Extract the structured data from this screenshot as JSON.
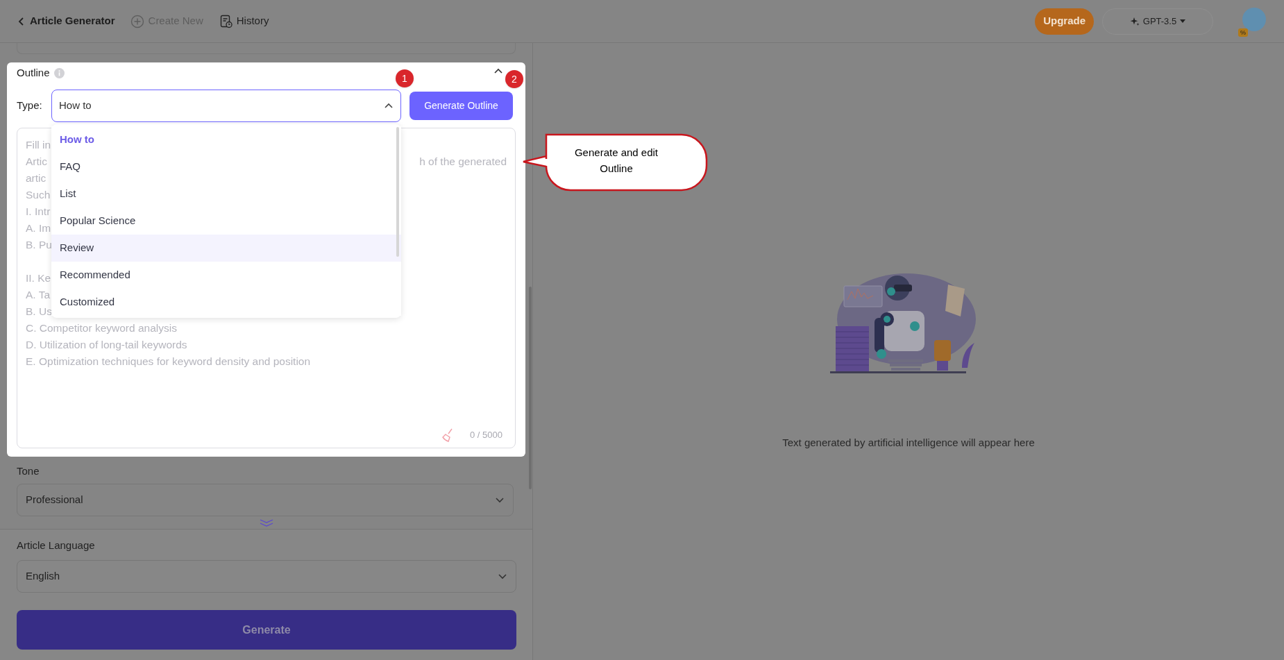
{
  "top_bar": {
    "back_label": "Article Generator",
    "create_new": "Create New",
    "history": "History",
    "upgrade": "Upgrade",
    "model": "GPT-3.5",
    "avatar_badge": "%"
  },
  "outline": {
    "title": "Outline",
    "expanded": true,
    "type_label": "Type:",
    "type_value": "How to",
    "dropdown_open": true,
    "options": [
      {
        "label": "How to",
        "selected": true,
        "hovered": false
      },
      {
        "label": "FAQ",
        "selected": false,
        "hovered": false
      },
      {
        "label": "List",
        "selected": false,
        "hovered": false
      },
      {
        "label": "Popular Science",
        "selected": false,
        "hovered": false
      },
      {
        "label": "Review",
        "selected": false,
        "hovered": true
      },
      {
        "label": "Recommended",
        "selected": false,
        "hovered": false
      },
      {
        "label": "Customized",
        "selected": false,
        "hovered": false
      }
    ],
    "generate_button": "Generate Outline",
    "placeholder_paragraphs": [
      [
        {
          "left": "Fill in"
        },
        {
          "left": "Artic",
          "right": "h of the generated"
        },
        {
          "left": "artic"
        },
        {
          "left": "Such"
        },
        {
          "left": "I. Intr"
        },
        {
          "left": "A. Im"
        },
        {
          "left": "B. Pu"
        }
      ],
      [
        {
          "left": "II. Ke"
        },
        {
          "left": "A. Ta"
        },
        {
          "left": "B. Us"
        },
        {
          "left": "C. Competitor keyword analysis"
        },
        {
          "left": "D. Utilization of long-tail keywords"
        },
        {
          "left": "E. Optimization techniques for keyword density and position"
        }
      ]
    ],
    "counter": "0 / 5000"
  },
  "step_badges": [
    "1",
    "2"
  ],
  "callout": {
    "text": "Generate and edit Outline"
  },
  "tone": {
    "label": "Tone",
    "value": "Professional"
  },
  "language": {
    "label": "Article Language",
    "value": "English"
  },
  "generate_button": "Generate",
  "output": {
    "empty_message": "Text generated by artificial intelligence will appear here"
  }
}
